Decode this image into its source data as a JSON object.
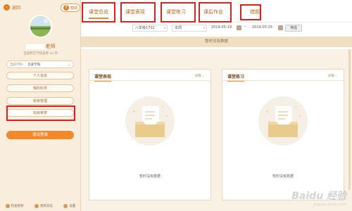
{
  "sidebar": {
    "back_label": "返回",
    "help_label": "帮助",
    "user_suffix": "老师",
    "school_text": "当前所在学校名称 xx 市",
    "subject": {
      "label": "当前学科：",
      "value": "历史学科"
    },
    "menu": [
      "个人信息",
      "我的科学",
      "班级管理",
      "班级荣誉"
    ],
    "logout_label": "退出登录",
    "footer": [
      "检查更新",
      "更新日志",
      "设置"
    ]
  },
  "tabs": [
    "课堂总览",
    "课堂表现",
    "课堂练习",
    "课后作业",
    "错题"
  ],
  "filters": {
    "class": "八年级1702",
    "range": "本周",
    "start_date": "2019-05-19",
    "end_date": "2019-05-25",
    "dash": "—",
    "query_label": "筛选"
  },
  "no_data_banner": "暂时没有数据",
  "cards": [
    {
      "title": "课堂表现",
      "more": "详情 ›",
      "empty": "暂时没有数据"
    },
    {
      "title": "课堂练习",
      "more": "详情 ›",
      "empty": "暂时没有数据"
    }
  ],
  "watermark": {
    "main": "Baidu 经验",
    "sub": "jingyan.baidu.com"
  },
  "colors": {
    "accent": "#f28a2c",
    "sidebar_bg": "#f9eedd",
    "highlight": "#e02020"
  }
}
